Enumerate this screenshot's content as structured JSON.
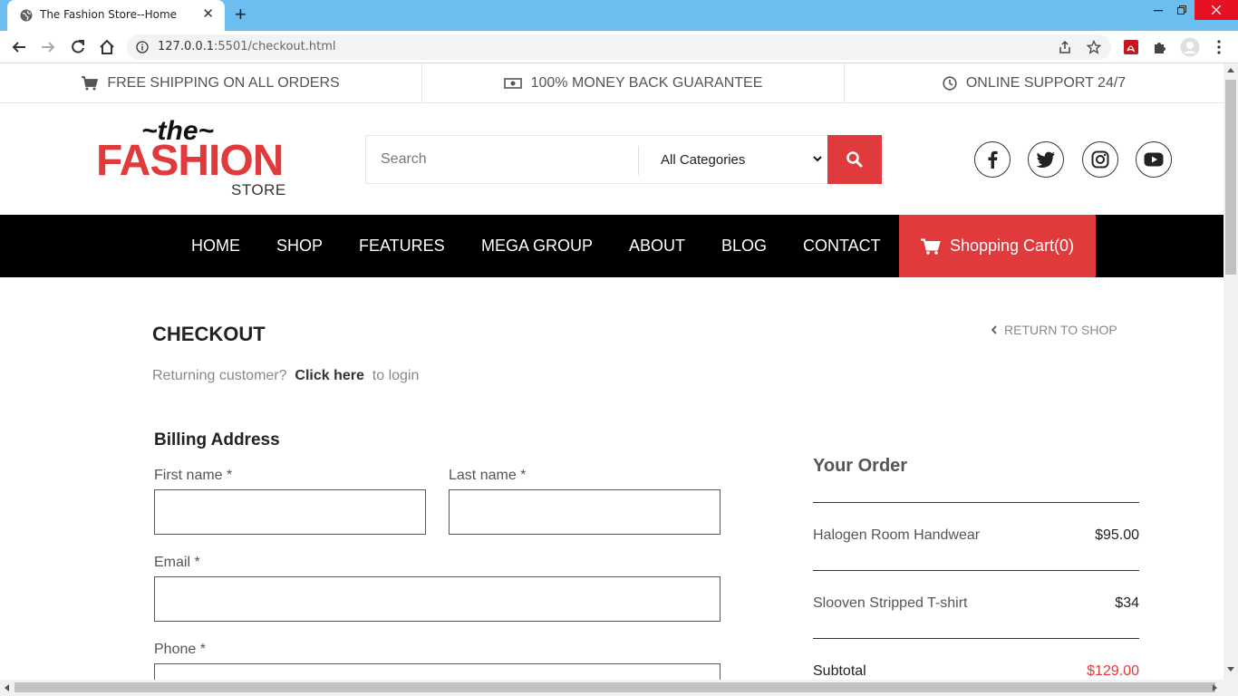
{
  "browser": {
    "tab_title": "The Fashion Store--Home",
    "url_host": "127.0.0.1",
    "url_rest": ":5501/checkout.html"
  },
  "topinfo": {
    "shipping": "FREE SHIPPING ON ALL ORDERS",
    "money_back": "100% MONEY BACK GUARANTEE",
    "support": "ONLINE SUPPORT 24/7"
  },
  "logo": {
    "the": "~the~",
    "fashion": "FASHION",
    "store": "STORE"
  },
  "search": {
    "placeholder": "Search",
    "category": "All Categories"
  },
  "nav": {
    "items": [
      "HOME",
      "SHOP",
      "FEATURES",
      "MEGA GROUP",
      "ABOUT",
      "BLOG",
      "CONTACT"
    ],
    "cart": "Shopping Cart(0)"
  },
  "checkout": {
    "title": "CHECKOUT",
    "return": "RETURN TO SHOP",
    "returning_pre": "Returning customer?",
    "click_here": "Click here",
    "returning_post": "to login"
  },
  "billing": {
    "title": "Billing Address",
    "first_name": "First name *",
    "last_name": "Last name *",
    "email": "Email *",
    "phone": "Phone *"
  },
  "order": {
    "title": "Your Order",
    "items": [
      {
        "name": "Halogen Room Handwear",
        "price": "$95.00"
      },
      {
        "name": "Slooven Stripped T-shirt",
        "price": "$34"
      }
    ],
    "subtotal_label": "Subtotal",
    "subtotal_value": "$129.00"
  },
  "colors": {
    "brand_red": "#e03a3c",
    "nav_bg": "#000000",
    "tabbar": "#6cbef0"
  }
}
